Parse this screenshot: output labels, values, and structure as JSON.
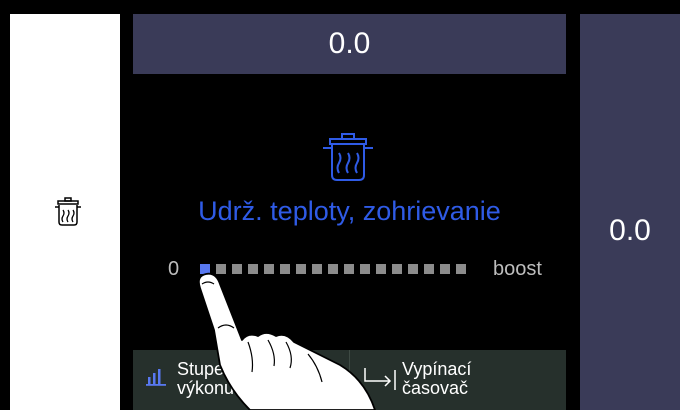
{
  "top_value": "0.0",
  "right_value": "0.0",
  "mode": {
    "title": "Udrž. teploty, zohrievanie",
    "icon": "pot-with-steam-icon"
  },
  "power_scale": {
    "min_label": "0",
    "max_label": "boost",
    "steps_total": 17,
    "active_step": 1
  },
  "bottom_buttons": {
    "power_level": {
      "line1": "Stupeň",
      "line2": "výkonu",
      "icon": "bars-icon"
    },
    "timer": {
      "line1": "Vypínací",
      "line2": "časovač",
      "icon": "timer-arrow-icon"
    }
  },
  "colors": {
    "accent": "#2f5be6",
    "active_step": "#5878f0",
    "panel": "#3a3b58",
    "bottom_bar": "#26302c"
  }
}
